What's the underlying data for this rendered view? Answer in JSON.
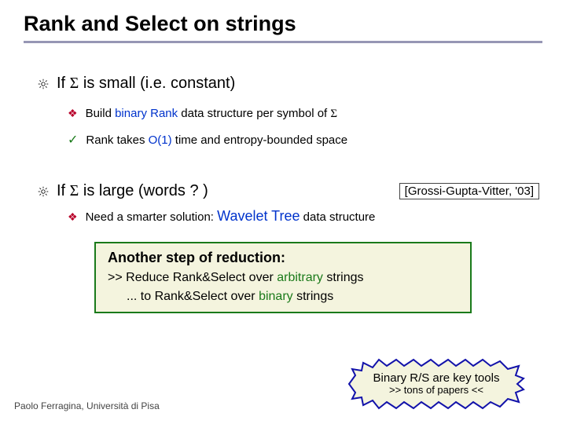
{
  "title": "Rank and Select on strings",
  "p1": {
    "prefix": "If ",
    "sigma": "Σ",
    "suffix": " is small (i.e. constant)"
  },
  "s1a": {
    "a": "Build ",
    "b": "binary Rank",
    "c": " data structure per symbol of ",
    "sigma": "Σ"
  },
  "s1b": {
    "a": "Rank takes ",
    "b": "O(1)",
    "c": " time and entropy-bounded space"
  },
  "p2": {
    "prefix": "If ",
    "sigma": "Σ",
    "suffix": " is large  (words ? )"
  },
  "cite": "[Grossi-Gupta-Vitter, '03]",
  "s2": {
    "a": "Need a smarter solution: ",
    "b": "Wavelet Tree",
    "c": " data structure"
  },
  "box": {
    "title": "Another step of reduction:",
    "l1a": ">>  Reduce Rank&Select over ",
    "l1b": "arbitrary",
    "l1c": " strings",
    "l2a": "... to Rank&Select over ",
    "l2b": "binary",
    "l2c": " strings"
  },
  "burst": {
    "l1": "Binary R/S are key tools",
    "l2": ">> tons of papers <<"
  },
  "footer": "Paolo Ferragina, Università di Pisa"
}
